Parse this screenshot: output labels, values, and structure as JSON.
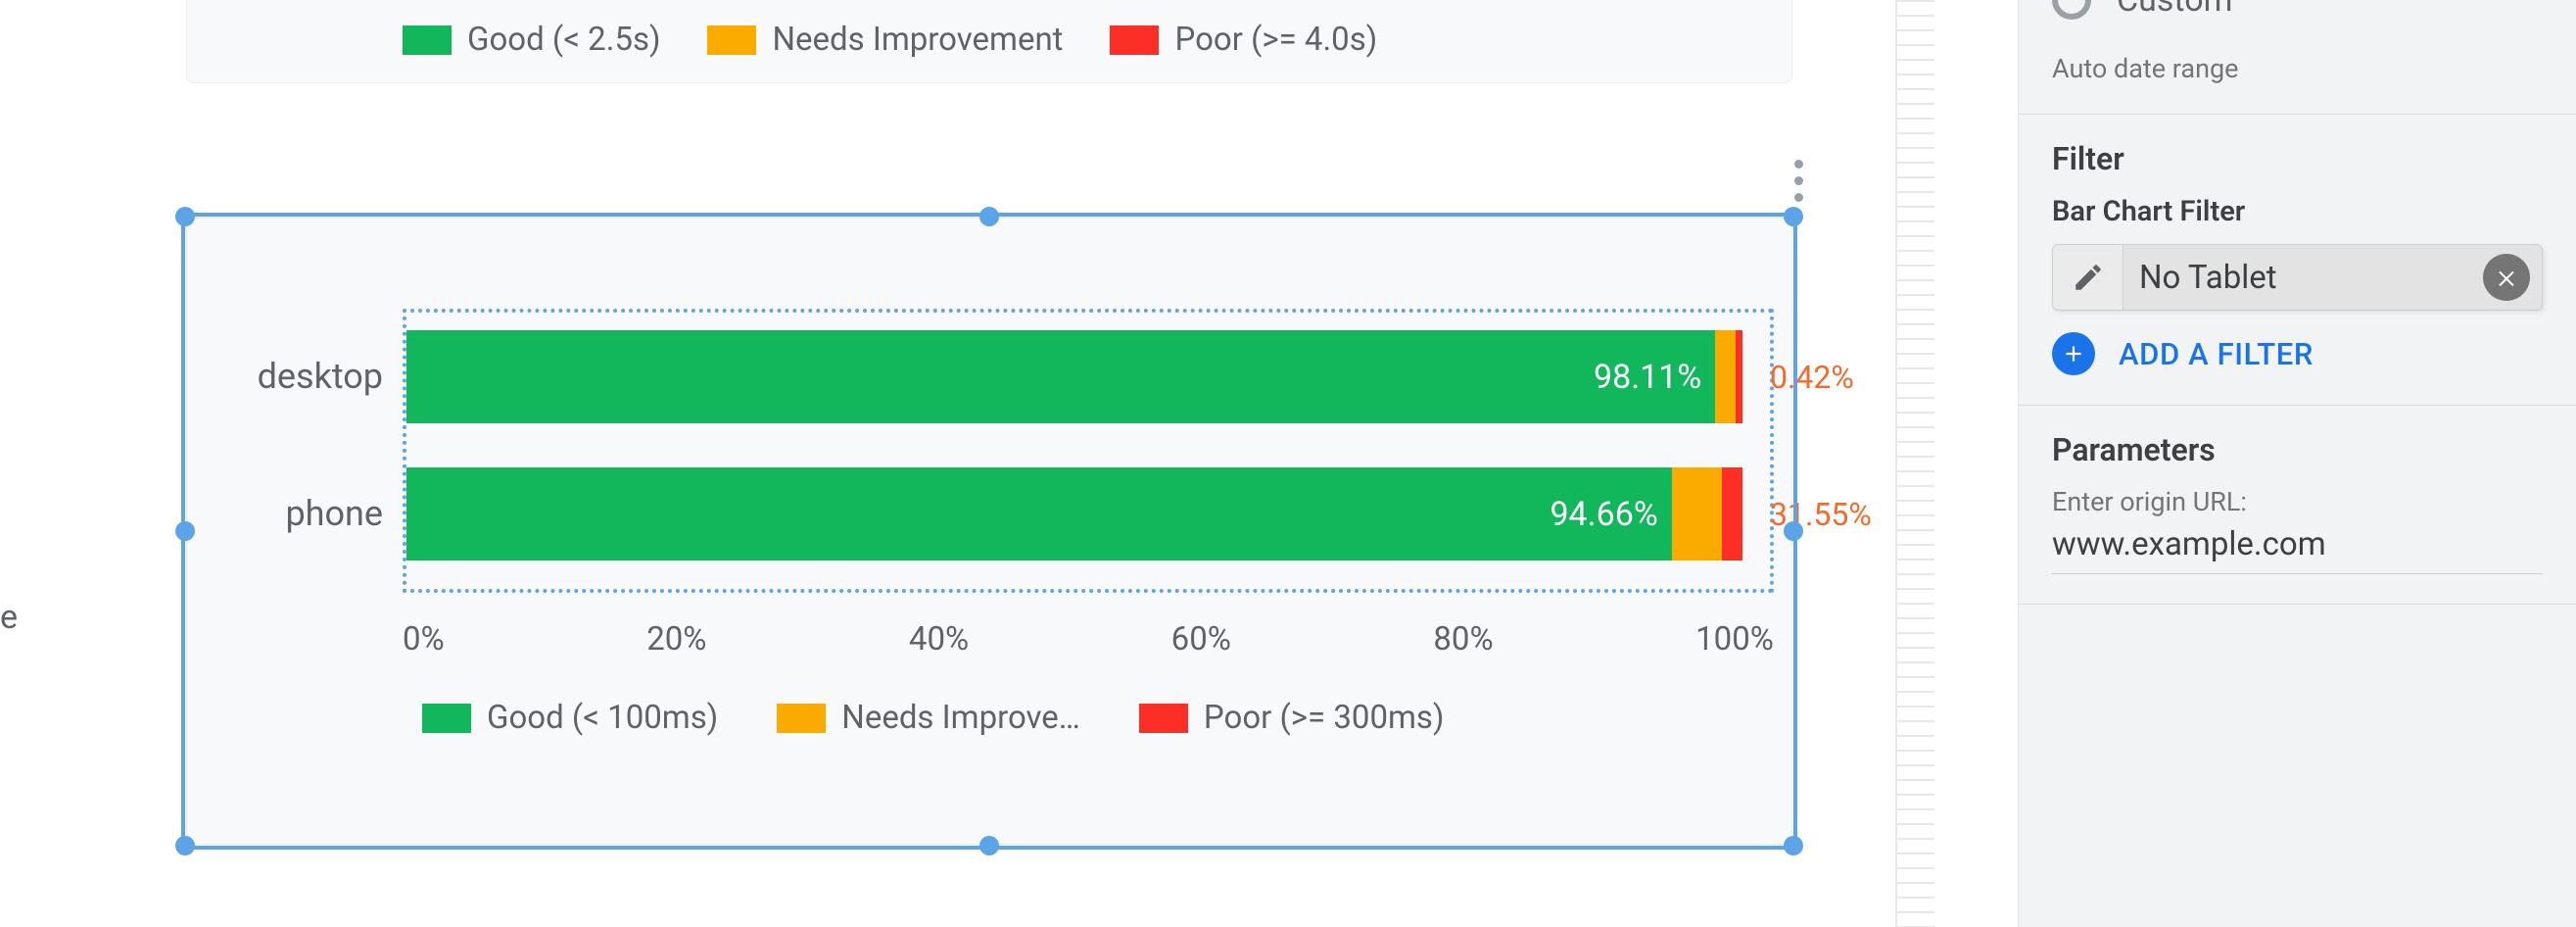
{
  "colors": {
    "good": "#12b75c",
    "needs_improvement": "#fbab00",
    "poor": "#fc2f27",
    "accent": "#1a73e8",
    "selection": "#5da3e8"
  },
  "top_legend": {
    "good": "Good (< 2.5s)",
    "needs_improvement": "Needs Improvement",
    "poor": "Poor (>= 4.0s)"
  },
  "chart": {
    "categories": {
      "desktop": "desktop",
      "phone": "phone"
    },
    "axis_ticks": [
      "0%",
      "20%",
      "40%",
      "60%",
      "80%",
      "100%"
    ],
    "labels": {
      "desktop_good": "98.11%",
      "desktop_tail": "0.42%",
      "phone_good": "94.66%",
      "phone_tail": "31.55%"
    },
    "legend": {
      "good": "Good (< 100ms)",
      "needs_improvement": "Needs Improve…",
      "poor": "Poor (>= 300ms)"
    }
  },
  "side": {
    "custom_option": "Custom",
    "auto_date": "Auto date range",
    "filter_head": "Filter",
    "filter_sub": "Bar Chart Filter",
    "filter_chip": "No Tablet",
    "add_filter": "ADD A FILTER",
    "params_head": "Parameters",
    "params_label": "Enter origin URL:",
    "params_value": "www.example.com"
  },
  "stray": {
    "e": "e"
  },
  "chart_data": {
    "type": "bar",
    "orientation": "horizontal",
    "stacked": true,
    "title": "",
    "xlabel": "",
    "ylabel": "",
    "xlim": [
      0,
      100
    ],
    "x_ticks": [
      0,
      20,
      40,
      60,
      80,
      100
    ],
    "categories": [
      "desktop",
      "phone"
    ],
    "series": [
      {
        "name": "Good (< 100ms)",
        "values": [
          98.11,
          94.66
        ]
      },
      {
        "name": "Needs Improvement",
        "values": [
          1.47,
          3.79
        ]
      },
      {
        "name": "Poor (>= 300ms)",
        "values": [
          0.42,
          1.55
        ]
      }
    ],
    "annotations": [
      {
        "category": "desktop",
        "series": "Good (< 100ms)",
        "text": "98.11%"
      },
      {
        "category": "desktop",
        "text": "0.42%"
      },
      {
        "category": "phone",
        "series": "Good (< 100ms)",
        "text": "94.66%"
      },
      {
        "category": "phone",
        "text": "31.55%"
      }
    ]
  }
}
